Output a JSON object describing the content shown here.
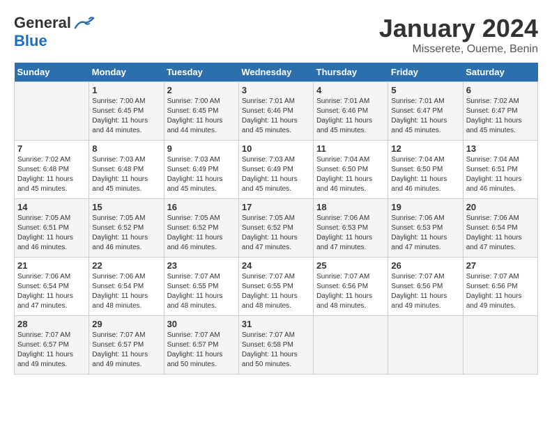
{
  "header": {
    "logo_general": "General",
    "logo_blue": "Blue",
    "title": "January 2024",
    "location": "Misserete, Oueme, Benin"
  },
  "days_of_week": [
    "Sunday",
    "Monday",
    "Tuesday",
    "Wednesday",
    "Thursday",
    "Friday",
    "Saturday"
  ],
  "weeks": [
    [
      {
        "day": "",
        "sunrise": "",
        "sunset": "",
        "daylight": ""
      },
      {
        "day": "1",
        "sunrise": "7:00 AM",
        "sunset": "6:45 PM",
        "daylight": "11 hours and 44 minutes."
      },
      {
        "day": "2",
        "sunrise": "7:00 AM",
        "sunset": "6:45 PM",
        "daylight": "11 hours and 44 minutes."
      },
      {
        "day": "3",
        "sunrise": "7:01 AM",
        "sunset": "6:46 PM",
        "daylight": "11 hours and 45 minutes."
      },
      {
        "day": "4",
        "sunrise": "7:01 AM",
        "sunset": "6:46 PM",
        "daylight": "11 hours and 45 minutes."
      },
      {
        "day": "5",
        "sunrise": "7:01 AM",
        "sunset": "6:47 PM",
        "daylight": "11 hours and 45 minutes."
      },
      {
        "day": "6",
        "sunrise": "7:02 AM",
        "sunset": "6:47 PM",
        "daylight": "11 hours and 45 minutes."
      }
    ],
    [
      {
        "day": "7",
        "sunrise": "7:02 AM",
        "sunset": "6:48 PM",
        "daylight": "11 hours and 45 minutes."
      },
      {
        "day": "8",
        "sunrise": "7:03 AM",
        "sunset": "6:48 PM",
        "daylight": "11 hours and 45 minutes."
      },
      {
        "day": "9",
        "sunrise": "7:03 AM",
        "sunset": "6:49 PM",
        "daylight": "11 hours and 45 minutes."
      },
      {
        "day": "10",
        "sunrise": "7:03 AM",
        "sunset": "6:49 PM",
        "daylight": "11 hours and 45 minutes."
      },
      {
        "day": "11",
        "sunrise": "7:04 AM",
        "sunset": "6:50 PM",
        "daylight": "11 hours and 46 minutes."
      },
      {
        "day": "12",
        "sunrise": "7:04 AM",
        "sunset": "6:50 PM",
        "daylight": "11 hours and 46 minutes."
      },
      {
        "day": "13",
        "sunrise": "7:04 AM",
        "sunset": "6:51 PM",
        "daylight": "11 hours and 46 minutes."
      }
    ],
    [
      {
        "day": "14",
        "sunrise": "7:05 AM",
        "sunset": "6:51 PM",
        "daylight": "11 hours and 46 minutes."
      },
      {
        "day": "15",
        "sunrise": "7:05 AM",
        "sunset": "6:52 PM",
        "daylight": "11 hours and 46 minutes."
      },
      {
        "day": "16",
        "sunrise": "7:05 AM",
        "sunset": "6:52 PM",
        "daylight": "11 hours and 46 minutes."
      },
      {
        "day": "17",
        "sunrise": "7:05 AM",
        "sunset": "6:52 PM",
        "daylight": "11 hours and 47 minutes."
      },
      {
        "day": "18",
        "sunrise": "7:06 AM",
        "sunset": "6:53 PM",
        "daylight": "11 hours and 47 minutes."
      },
      {
        "day": "19",
        "sunrise": "7:06 AM",
        "sunset": "6:53 PM",
        "daylight": "11 hours and 47 minutes."
      },
      {
        "day": "20",
        "sunrise": "7:06 AM",
        "sunset": "6:54 PM",
        "daylight": "11 hours and 47 minutes."
      }
    ],
    [
      {
        "day": "21",
        "sunrise": "7:06 AM",
        "sunset": "6:54 PM",
        "daylight": "11 hours and 47 minutes."
      },
      {
        "day": "22",
        "sunrise": "7:06 AM",
        "sunset": "6:54 PM",
        "daylight": "11 hours and 48 minutes."
      },
      {
        "day": "23",
        "sunrise": "7:07 AM",
        "sunset": "6:55 PM",
        "daylight": "11 hours and 48 minutes."
      },
      {
        "day": "24",
        "sunrise": "7:07 AM",
        "sunset": "6:55 PM",
        "daylight": "11 hours and 48 minutes."
      },
      {
        "day": "25",
        "sunrise": "7:07 AM",
        "sunset": "6:56 PM",
        "daylight": "11 hours and 48 minutes."
      },
      {
        "day": "26",
        "sunrise": "7:07 AM",
        "sunset": "6:56 PM",
        "daylight": "11 hours and 49 minutes."
      },
      {
        "day": "27",
        "sunrise": "7:07 AM",
        "sunset": "6:56 PM",
        "daylight": "11 hours and 49 minutes."
      }
    ],
    [
      {
        "day": "28",
        "sunrise": "7:07 AM",
        "sunset": "6:57 PM",
        "daylight": "11 hours and 49 minutes."
      },
      {
        "day": "29",
        "sunrise": "7:07 AM",
        "sunset": "6:57 PM",
        "daylight": "11 hours and 49 minutes."
      },
      {
        "day": "30",
        "sunrise": "7:07 AM",
        "sunset": "6:57 PM",
        "daylight": "11 hours and 50 minutes."
      },
      {
        "day": "31",
        "sunrise": "7:07 AM",
        "sunset": "6:58 PM",
        "daylight": "11 hours and 50 minutes."
      },
      {
        "day": "",
        "sunrise": "",
        "sunset": "",
        "daylight": ""
      },
      {
        "day": "",
        "sunrise": "",
        "sunset": "",
        "daylight": ""
      },
      {
        "day": "",
        "sunrise": "",
        "sunset": "",
        "daylight": ""
      }
    ]
  ]
}
